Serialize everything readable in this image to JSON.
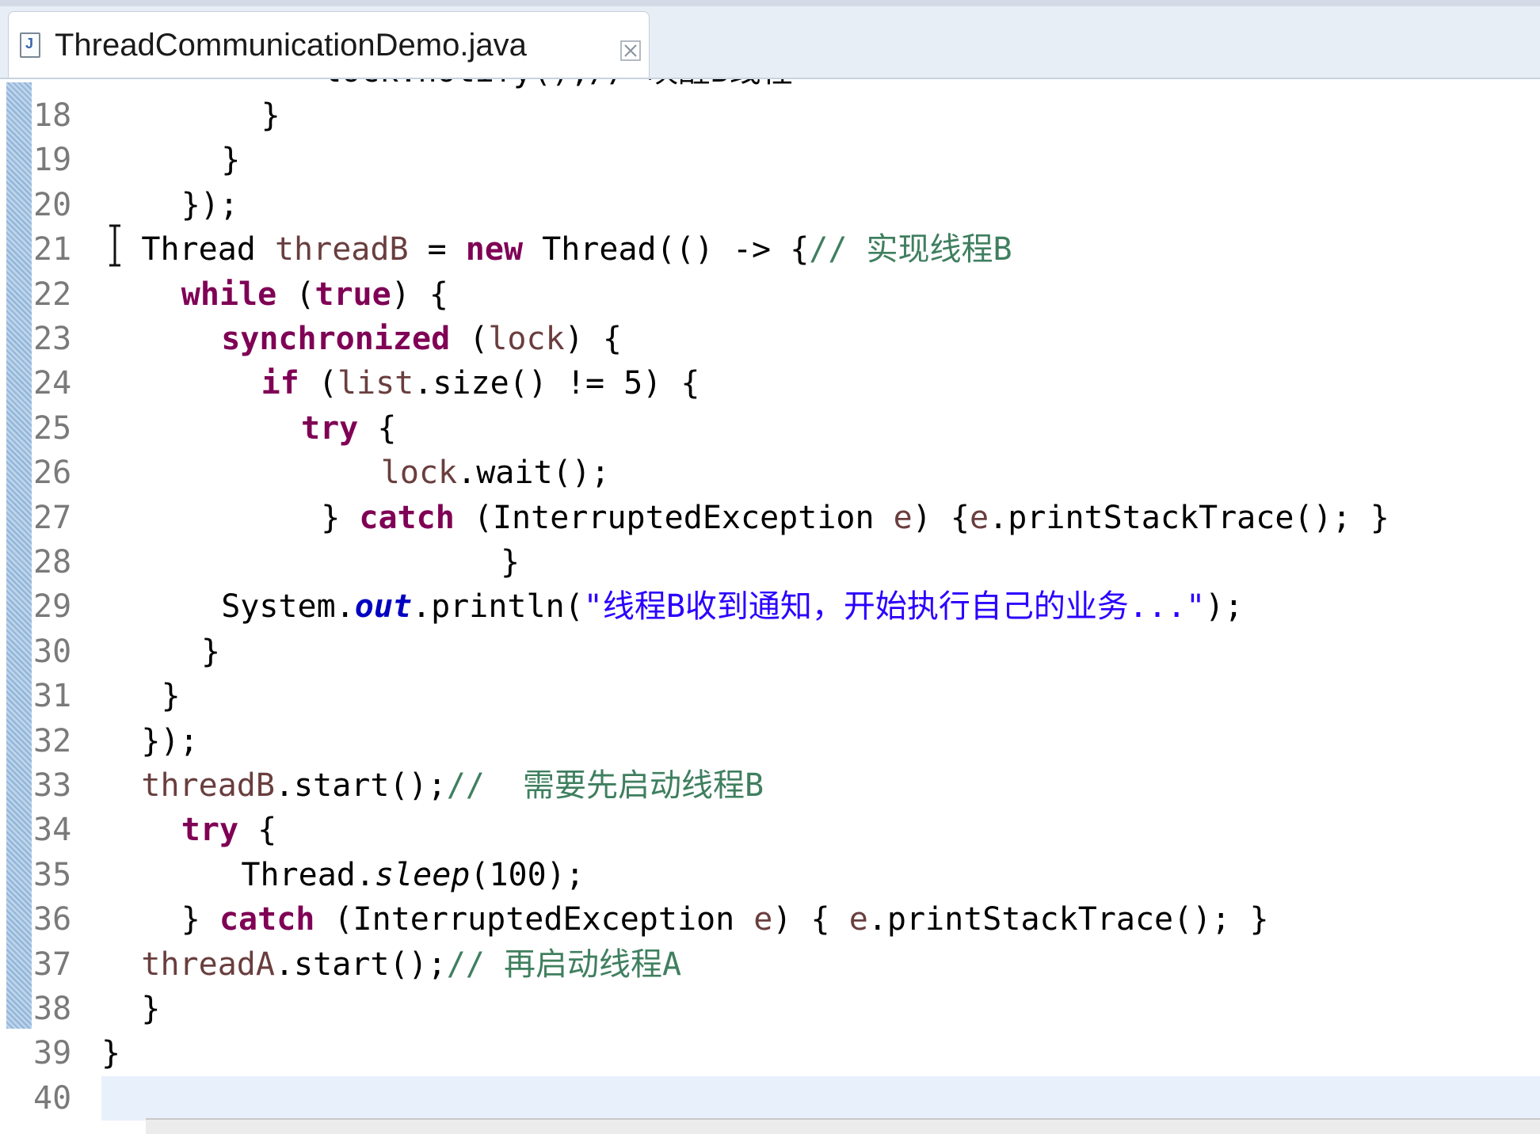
{
  "tab": {
    "icon": "java-file-icon",
    "title": "ThreadCommunicationDemo.java",
    "close_icon": "close-icon"
  },
  "editor": {
    "partial_top_line": "lock.notify();// 唤醒B线程",
    "lines": [
      {
        "num": "18",
        "indent": 8,
        "tokens": [
          {
            "t": "}",
            "c": "plain"
          }
        ]
      },
      {
        "num": "19",
        "indent": 6,
        "tokens": [
          {
            "t": "}",
            "c": "plain"
          }
        ]
      },
      {
        "num": "20",
        "indent": 4,
        "tokens": [
          {
            "t": "});",
            "c": "plain"
          }
        ]
      },
      {
        "num": "21",
        "indent": 2,
        "tokens": [
          {
            "t": "Thread ",
            "c": "plain"
          },
          {
            "t": "threadB",
            "c": "var"
          },
          {
            "t": " = ",
            "c": "plain"
          },
          {
            "t": "new",
            "c": "kw"
          },
          {
            "t": " Thread(() -> {",
            "c": "plain"
          },
          {
            "t": "// 实现线程B",
            "c": "com"
          }
        ]
      },
      {
        "num": "22",
        "indent": 4,
        "tokens": [
          {
            "t": "while",
            "c": "kw"
          },
          {
            "t": " (",
            "c": "plain"
          },
          {
            "t": "true",
            "c": "kw"
          },
          {
            "t": ") {",
            "c": "plain"
          }
        ]
      },
      {
        "num": "23",
        "indent": 6,
        "tokens": [
          {
            "t": "synchronized",
            "c": "kw"
          },
          {
            "t": " (",
            "c": "plain"
          },
          {
            "t": "lock",
            "c": "var"
          },
          {
            "t": ") {",
            "c": "plain"
          }
        ]
      },
      {
        "num": "24",
        "indent": 8,
        "tokens": [
          {
            "t": "if",
            "c": "kw"
          },
          {
            "t": " (",
            "c": "plain"
          },
          {
            "t": "list",
            "c": "var"
          },
          {
            "t": ".size() != 5) {",
            "c": "plain"
          }
        ]
      },
      {
        "num": "25",
        "indent": 10,
        "tokens": [
          {
            "t": "try",
            "c": "kw"
          },
          {
            "t": " {",
            "c": "plain"
          }
        ]
      },
      {
        "num": "26",
        "indent": 14,
        "tokens": [
          {
            "t": "lock",
            "c": "var"
          },
          {
            "t": ".wait();",
            "c": "plain"
          }
        ]
      },
      {
        "num": "27",
        "indent": 11,
        "tokens": [
          {
            "t": "} ",
            "c": "plain"
          },
          {
            "t": "catch",
            "c": "kw"
          },
          {
            "t": " (InterruptedException ",
            "c": "plain"
          },
          {
            "t": "e",
            "c": "var"
          },
          {
            "t": ") {",
            "c": "plain"
          },
          {
            "t": "e",
            "c": "var"
          },
          {
            "t": ".printStackTrace(); }",
            "c": "plain"
          }
        ]
      },
      {
        "num": "28",
        "indent": 20,
        "tokens": [
          {
            "t": "}",
            "c": "plain"
          }
        ]
      },
      {
        "num": "29",
        "indent": 6,
        "tokens": [
          {
            "t": "System.",
            "c": "plain"
          },
          {
            "t": "out",
            "c": "fld"
          },
          {
            "t": ".println(",
            "c": "plain"
          },
          {
            "t": "\"线程B收到通知，开始执行自己的业务...\"",
            "c": "str"
          },
          {
            "t": ");",
            "c": "plain"
          }
        ]
      },
      {
        "num": "30",
        "indent": 5,
        "tokens": [
          {
            "t": "}",
            "c": "plain"
          }
        ]
      },
      {
        "num": "31",
        "indent": 3,
        "tokens": [
          {
            "t": "}",
            "c": "plain"
          }
        ]
      },
      {
        "num": "32",
        "indent": 2,
        "tokens": [
          {
            "t": "});",
            "c": "plain"
          }
        ]
      },
      {
        "num": "33",
        "indent": 2,
        "tokens": [
          {
            "t": "threadB",
            "c": "var"
          },
          {
            "t": ".start();",
            "c": "plain"
          },
          {
            "t": "//  需要先启动线程B",
            "c": "com"
          }
        ]
      },
      {
        "num": "34",
        "indent": 4,
        "tokens": [
          {
            "t": "try",
            "c": "kw"
          },
          {
            "t": " {",
            "c": "plain"
          }
        ]
      },
      {
        "num": "35",
        "indent": 7,
        "tokens": [
          {
            "t": "Thread.",
            "c": "plain"
          },
          {
            "t": "sleep",
            "c": "ital"
          },
          {
            "t": "(100);",
            "c": "plain"
          }
        ]
      },
      {
        "num": "36",
        "indent": 4,
        "tokens": [
          {
            "t": "} ",
            "c": "plain"
          },
          {
            "t": "catch",
            "c": "kw"
          },
          {
            "t": " (InterruptedException ",
            "c": "plain"
          },
          {
            "t": "e",
            "c": "var"
          },
          {
            "t": ") { ",
            "c": "plain"
          },
          {
            "t": "e",
            "c": "var"
          },
          {
            "t": ".printStackTrace(); }",
            "c": "plain"
          }
        ]
      },
      {
        "num": "37",
        "indent": 2,
        "tokens": [
          {
            "t": "threadA",
            "c": "var"
          },
          {
            "t": ".start();",
            "c": "plain"
          },
          {
            "t": "// 再启动线程A",
            "c": "com"
          }
        ]
      },
      {
        "num": "38",
        "indent": 2,
        "tokens": [
          {
            "t": "}",
            "c": "plain"
          }
        ]
      },
      {
        "num": "39",
        "indent": 0,
        "tokens": [
          {
            "t": "}",
            "c": "plain"
          }
        ]
      },
      {
        "num": "40",
        "indent": 0,
        "tokens": [],
        "current": true
      }
    ]
  },
  "cursor_icon": "text-cursor-icon"
}
